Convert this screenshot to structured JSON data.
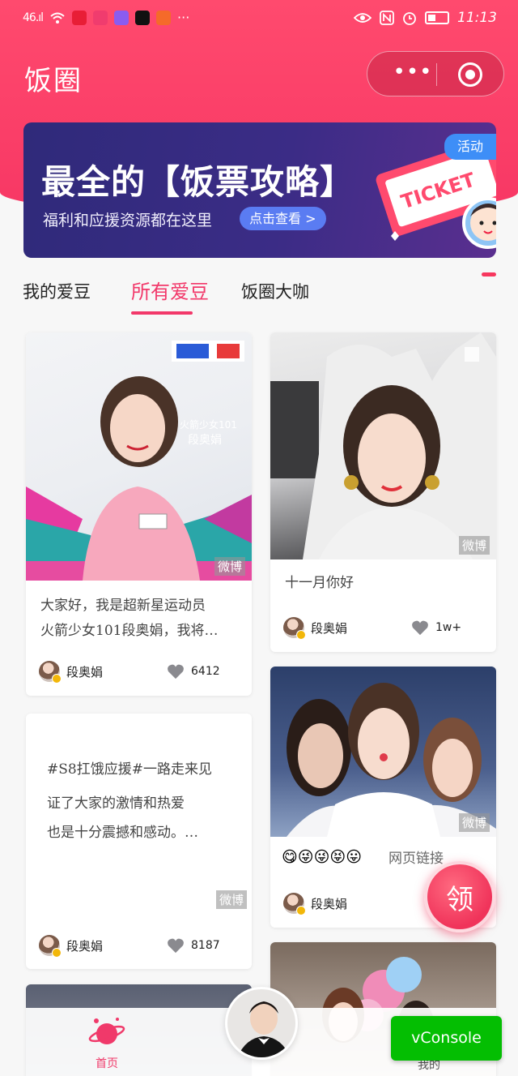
{
  "status_bar": {
    "signal": "46.ıl",
    "time": "11:13"
  },
  "header": {
    "title": "饭圈",
    "capsule_dots": "•••"
  },
  "banner": {
    "title": "最全的【饭票攻略】",
    "subtitle": "福利和应援资源都在这里",
    "button": "点击查看 >",
    "tag": "活动",
    "ticket_text": "TICKET"
  },
  "tabs": [
    {
      "label": "我的爱豆",
      "active": false
    },
    {
      "label": "所有爱豆",
      "active": true
    },
    {
      "label": "饭圈大咖",
      "active": false
    }
  ],
  "posts": [
    {
      "overlay_text_1": "火箭少女101",
      "overlay_text_2": "段奥娟",
      "watermark": "微博",
      "text_line1": "大家好，我是超新星运动员",
      "text_line2": "火箭少女101段奥娟，我将…",
      "author": "段奥娟",
      "likes": "6412"
    },
    {
      "watermark": "微博",
      "text_line1": "十一月你好",
      "author": "段奥娟",
      "likes": "1w+"
    },
    {
      "text_line1": "#S8扛饿应援#一路走来见",
      "text_line2": "证了大家的激情和热爱",
      "text_line3": "也是十分震撼和感动。…",
      "watermark": "微博",
      "author": "段奥娟",
      "likes": "8187"
    },
    {
      "watermark": "微博",
      "emojis": "😋😜😜😝😛",
      "link": "网页链接",
      "author": "段奥娟"
    }
  ],
  "float_button": "领",
  "bottom_nav": {
    "home": "首页",
    "mine": "我的"
  },
  "vconsole": "vConsole",
  "colors": {
    "accent": "#f2386a",
    "header": "#f73764",
    "vconsole": "#04be02"
  }
}
